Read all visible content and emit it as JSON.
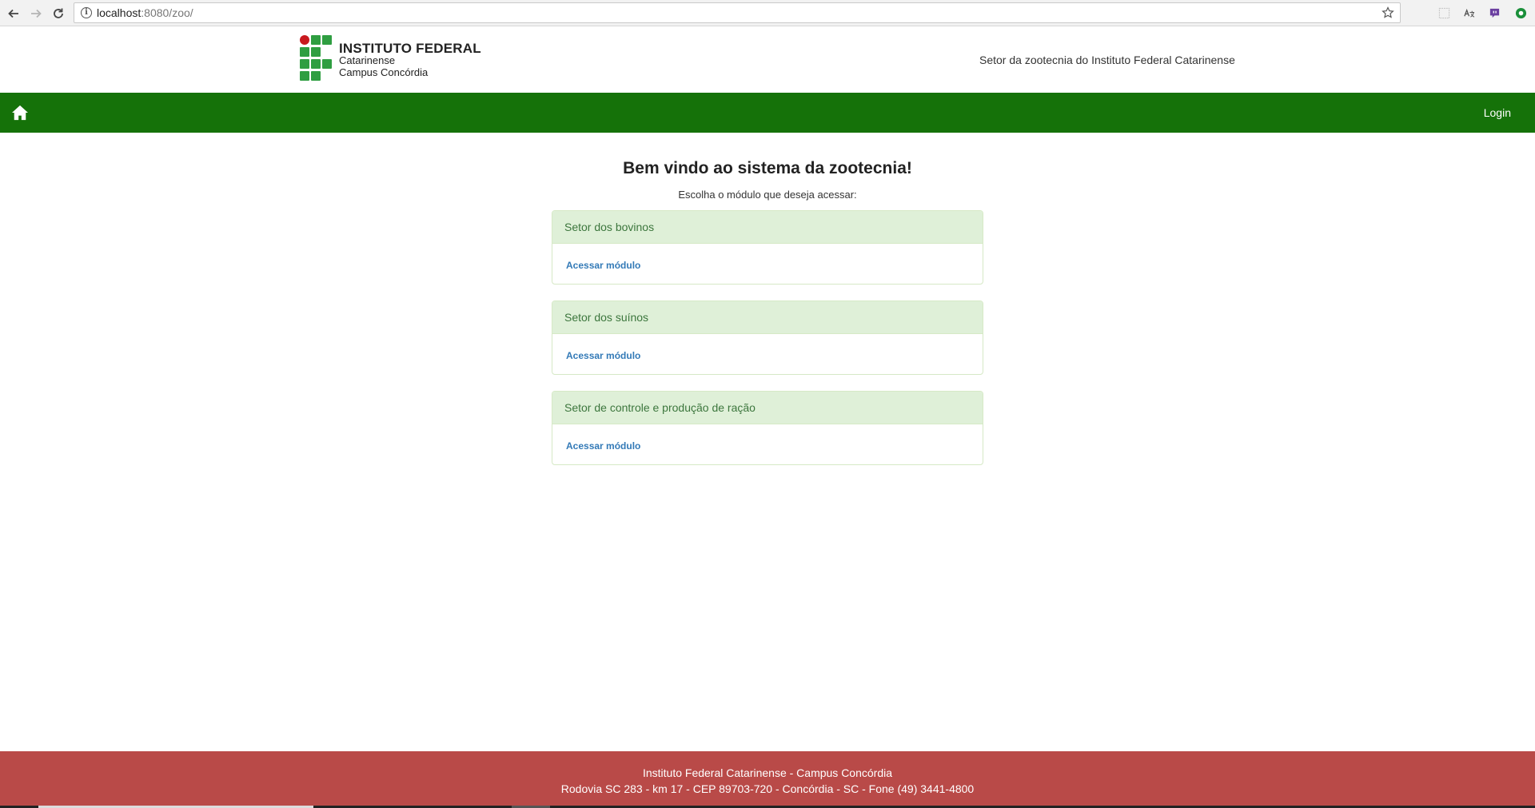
{
  "browser": {
    "url_host": "localhost",
    "url_rest": ":8080/zoo/"
  },
  "header": {
    "logo": {
      "line1": "INSTITUTO FEDERAL",
      "line2": "Catarinense",
      "line3": "Campus Concórdia"
    },
    "tagline": "Setor da zootecnia do Instituto Federal Catarinense"
  },
  "navbar": {
    "login_label": "Login",
    "background": "#157209"
  },
  "main": {
    "title": "Bem vindo ao sistema da zootecnia!",
    "subtitle": "Escolha o módulo que deseja acessar:",
    "modules": [
      {
        "title": "Setor dos bovinos",
        "link_label": "Acessar módulo"
      },
      {
        "title": "Setor dos suínos",
        "link_label": "Acessar módulo"
      },
      {
        "title": "Setor de controle e produção de ração",
        "link_label": "Acessar módulo"
      }
    ]
  },
  "footer": {
    "line1": "Instituto Federal Catarinense - Campus Concórdia",
    "line2": "Rodovia SC 283 - km 17 - CEP 89703-720 - Concórdia - SC - Fone (49) 3441-4800",
    "background": "#b94a48"
  }
}
